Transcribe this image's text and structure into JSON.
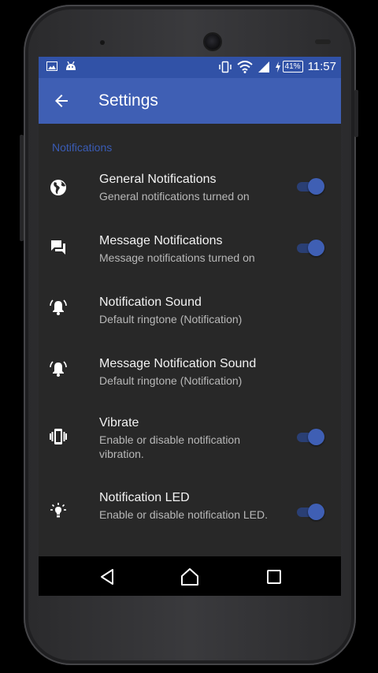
{
  "status_bar": {
    "time": "11:57",
    "battery": "41%",
    "left_icons": [
      "image-notification-icon",
      "android-notification-icon"
    ],
    "right_icons": [
      "vibrate-mode-icon",
      "wifi-icon",
      "cell-signal-icon",
      "battery-charging-icon"
    ]
  },
  "app_bar": {
    "title": "Settings",
    "back_icon": "arrow-back-icon"
  },
  "section_header": "Notifications",
  "settings": [
    {
      "title": "General Notifications",
      "subtitle": "General notifications turned on",
      "icon": "globe-icon",
      "toggle": true,
      "on": true
    },
    {
      "title": "Message Notifications",
      "subtitle": "Message notifications turned on",
      "icon": "chat-bubbles-icon",
      "toggle": true,
      "on": true
    },
    {
      "title": "Notification Sound",
      "subtitle": "Default ringtone (Notification)",
      "icon": "bell-ringing-icon",
      "toggle": false
    },
    {
      "title": "Message Notification Sound",
      "subtitle": "Default ringtone (Notification)",
      "icon": "bell-ringing-icon",
      "toggle": false
    },
    {
      "title": "Vibrate",
      "subtitle": "Enable or disable notification vibration.",
      "icon": "vibrate-icon",
      "toggle": true,
      "on": true
    },
    {
      "title": "Notification LED",
      "subtitle": "Enable or disable notification LED.",
      "icon": "lightbulb-icon",
      "toggle": true,
      "on": true
    }
  ],
  "nav_bar": {
    "icons": [
      "nav-back-icon",
      "nav-home-icon",
      "nav-recents-icon"
    ]
  },
  "colors": {
    "accent": "#3f5fb4",
    "status_bar": "#3152a7",
    "background": "#282828",
    "section_text": "#3a5cb6"
  }
}
